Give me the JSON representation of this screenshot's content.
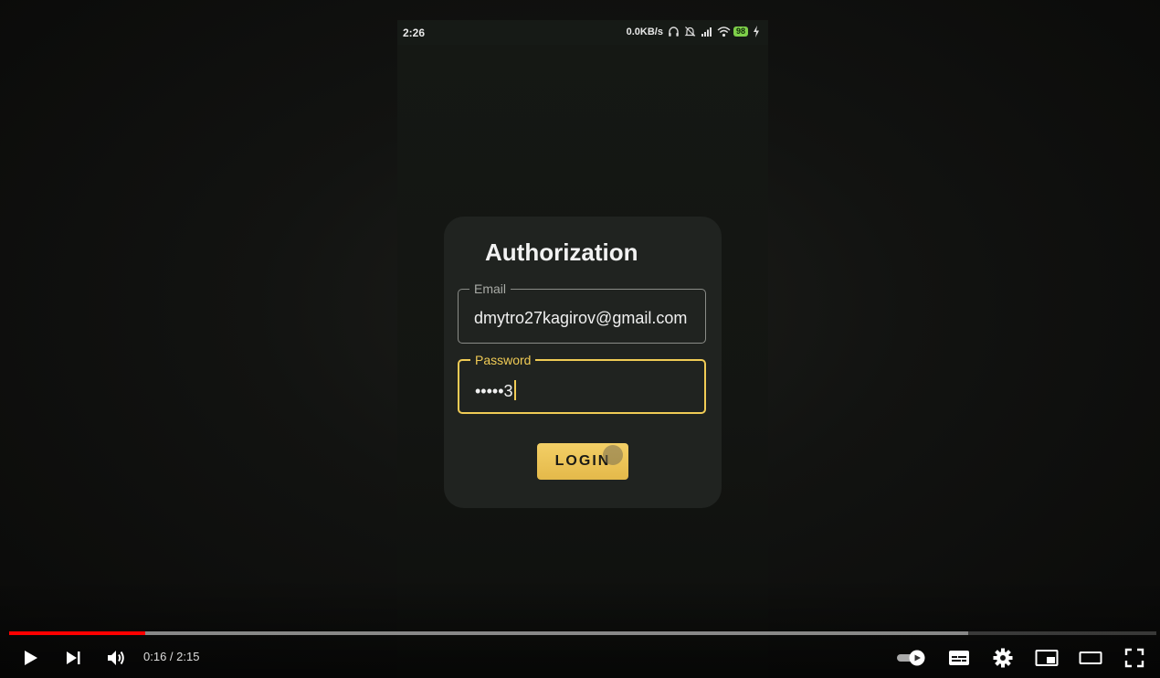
{
  "phone": {
    "status_bar": {
      "time": "2:26",
      "network_speed": "0.0KB/s",
      "battery": "98",
      "icons": [
        "headphones-icon",
        "alarm-off-icon",
        "signal-icon",
        "wifi-icon",
        "battery-icon",
        "charging-icon"
      ]
    },
    "card": {
      "title": "Authorization",
      "email": {
        "label": "Email",
        "value": "dmytro27kagirov@gmail.com"
      },
      "password": {
        "label": "Password",
        "value": "•••••3"
      },
      "login_label": "LOGIN"
    }
  },
  "player": {
    "current_time": "0:16",
    "duration": "2:15",
    "time_display": "0:16 / 2:15",
    "progress_played": 0.1185,
    "progress_buffered": 0.836,
    "colors": {
      "progress": "#ff0000",
      "accent": "#f0cb55"
    }
  }
}
